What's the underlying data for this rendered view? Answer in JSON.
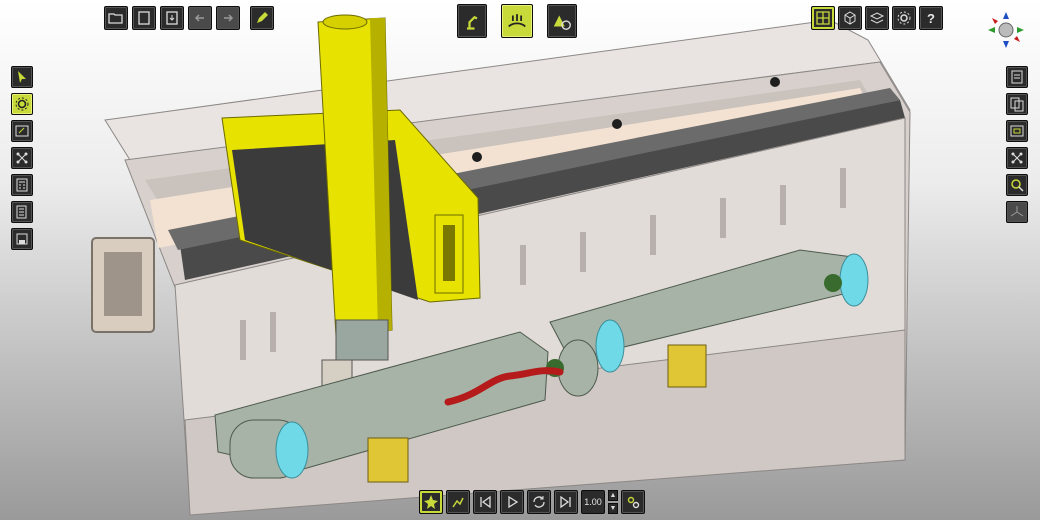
{
  "app": {
    "accent_color": "#c8d93a",
    "machine_colors": {
      "gantry": "#e8e200",
      "frame": "#d8d2cf",
      "beam": "#a6b3a6",
      "axis_cyan": "#6fd9e8",
      "robot_red": "#b51b1b",
      "panel_yellow": "#e0c534"
    }
  },
  "toolbar_top_left": {
    "items": [
      {
        "icon": "folder-open-icon"
      },
      {
        "icon": "document-icon"
      },
      {
        "icon": "save-icon"
      },
      {
        "icon": "arrow-left-icon"
      },
      {
        "icon": "arrow-right-icon"
      },
      {
        "icon": "pencil-icon"
      }
    ]
  },
  "toolbar_top_center": {
    "items": [
      {
        "icon": "robot-arm-icon"
      },
      {
        "icon": "machining-process-icon",
        "active": true
      },
      {
        "icon": "shapes-icon"
      }
    ]
  },
  "toolbar_top_right": {
    "items": [
      {
        "icon": "layout-grid-icon"
      },
      {
        "icon": "cube-view-icon"
      },
      {
        "icon": "layers-icon"
      },
      {
        "icon": "settings-gear-icon"
      },
      {
        "icon": "help-icon",
        "label": "?"
      }
    ]
  },
  "view_gizmo": {
    "icon": "axis-orientation-gizmo-icon"
  },
  "toolbar_left": {
    "items": [
      {
        "icon": "select-cursor-icon"
      },
      {
        "icon": "process-gear-icon",
        "active": true
      },
      {
        "icon": "edit-panel-icon"
      },
      {
        "icon": "node-graph-icon"
      },
      {
        "icon": "calculator-icon"
      },
      {
        "icon": "report-document-icon"
      },
      {
        "icon": "save-disk-icon"
      }
    ]
  },
  "toolbar_right": {
    "items": [
      {
        "icon": "report-icon"
      },
      {
        "icon": "copy-documents-icon"
      },
      {
        "icon": "frame-view-icon"
      },
      {
        "icon": "node-graph-icon"
      },
      {
        "icon": "inspect-icon"
      },
      {
        "icon": "coordinate-axes-icon",
        "disabled": true
      }
    ]
  },
  "playback_bar": {
    "speed": "1.00",
    "items": [
      {
        "icon": "simulation-collision-icon",
        "active": true
      },
      {
        "icon": "run-path-icon"
      },
      {
        "icon": "skip-to-start-icon"
      },
      {
        "icon": "play-icon"
      },
      {
        "icon": "loop-icon"
      },
      {
        "icon": "skip-to-end-icon"
      }
    ],
    "settings_icon": "playback-settings-icon"
  }
}
